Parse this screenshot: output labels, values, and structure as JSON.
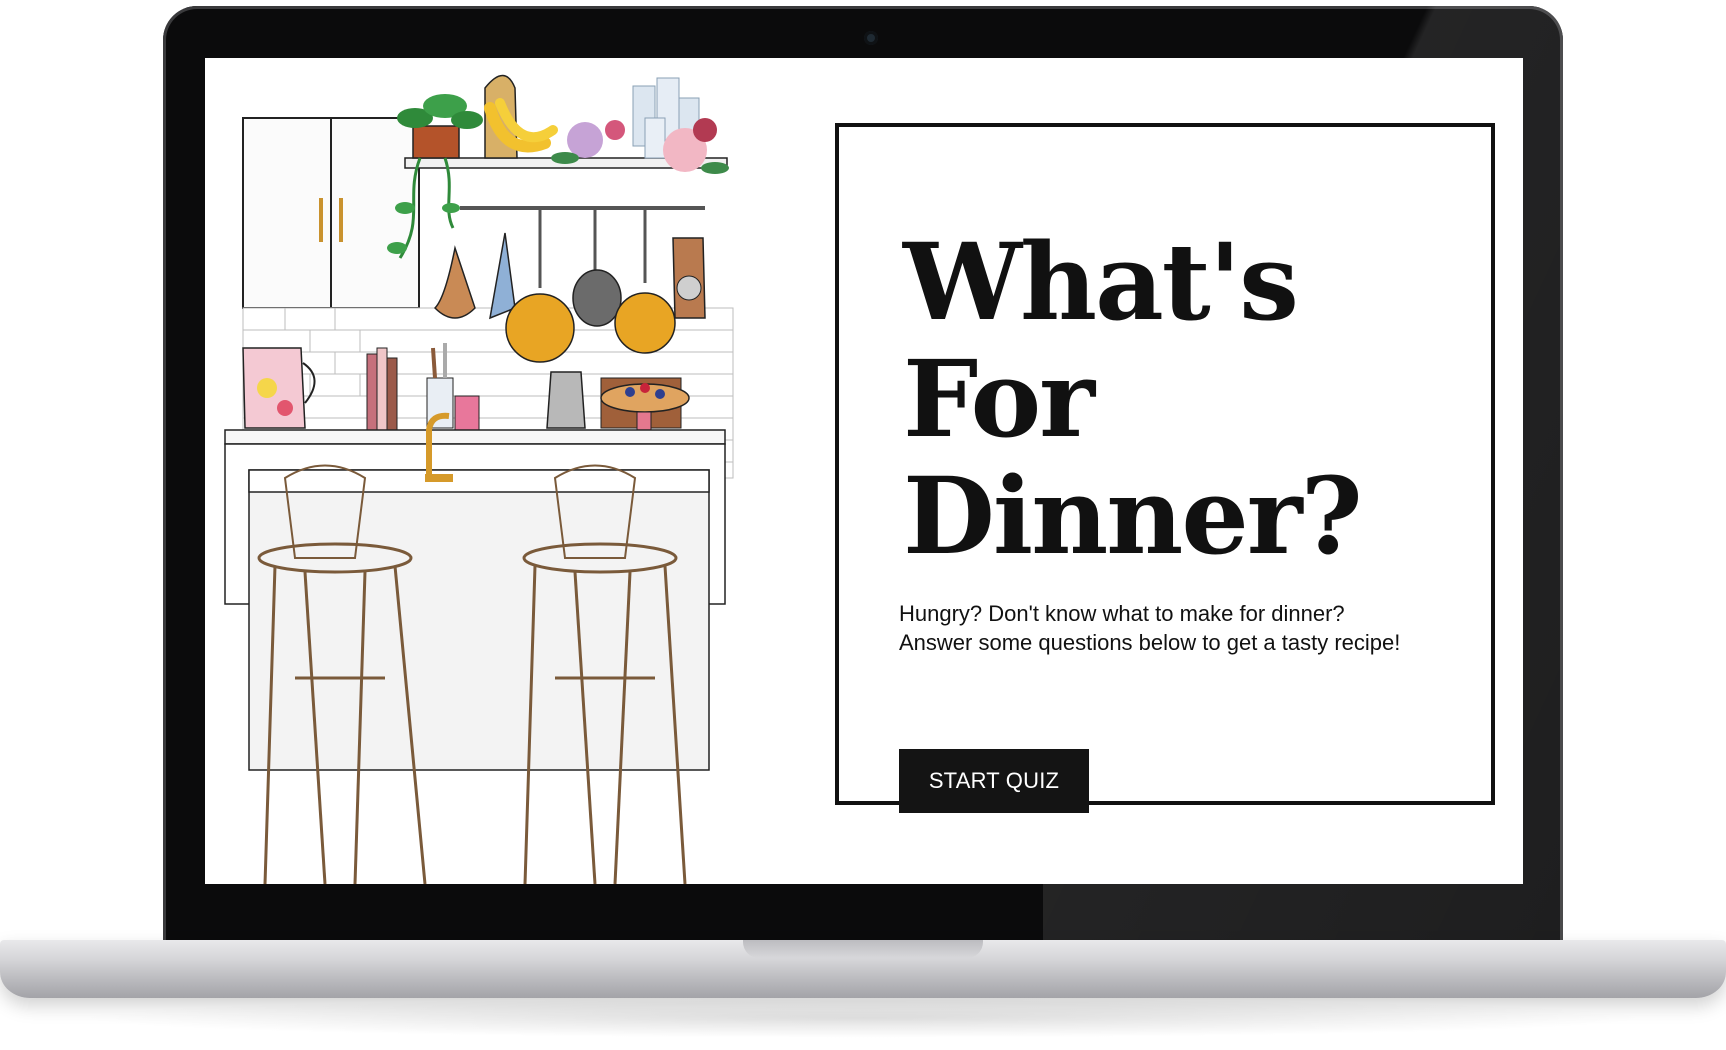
{
  "hero": {
    "title_lines": [
      "What's",
      "For",
      "Dinner?"
    ],
    "description_lines": [
      "Hungry? Don't know what to make for dinner?",
      "Answer some questions below to get a tasty recipe!"
    ],
    "button_label": "START QUIZ"
  },
  "illustration": {
    "subject": "kitchen illustration",
    "icons": [
      "plant-icon",
      "banana-icon",
      "candles-icon",
      "flowers-icon",
      "pitcher-icon",
      "books-icon",
      "utensils-icon",
      "pans-icon",
      "moka-pot-icon",
      "pie-icon",
      "faucet-icon",
      "bar-stool-icon"
    ]
  },
  "colors": {
    "button_bg": "#141414",
    "button_text": "#ffffff",
    "title": "#111111",
    "frame": "#0b0b0c"
  }
}
